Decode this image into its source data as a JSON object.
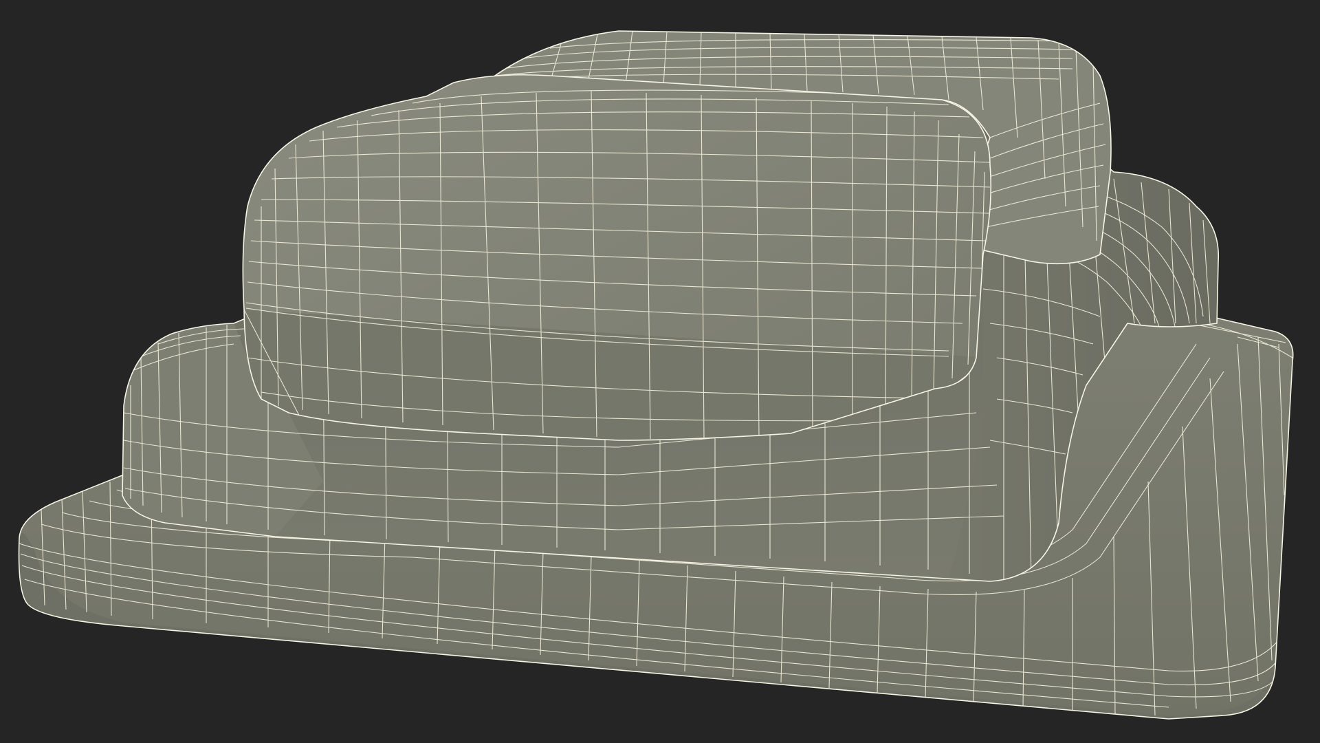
{
  "scene": {
    "subject": "wireframe-3d-model",
    "background_color": "#252525",
    "surface_color": "#7b7c70",
    "surface_shadow_color": "#66675d",
    "surface_highlight_color": "#8a8b7f",
    "wire_color": "#f2f0dc"
  }
}
